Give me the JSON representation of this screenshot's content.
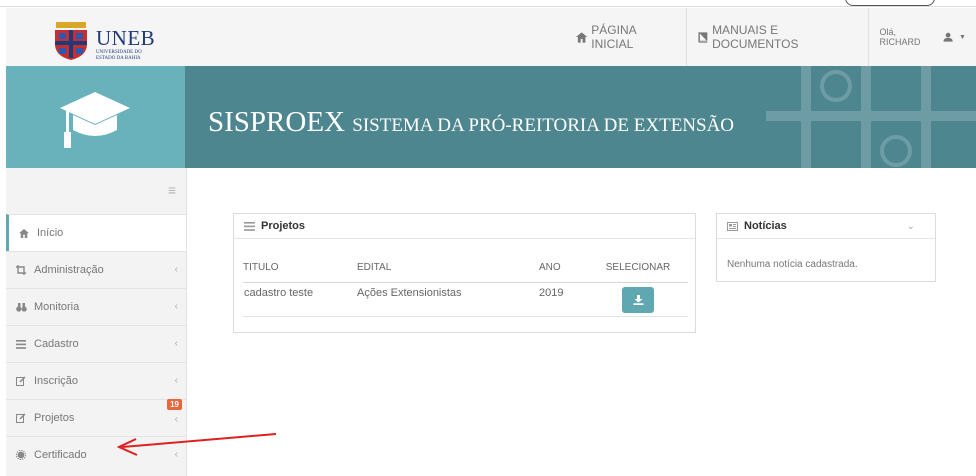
{
  "header": {
    "logo_text": "UNEB",
    "logo_subtitle": "UNIVERSIDADE DO ESTADO DA BAHIA",
    "nav": {
      "home_label": "PÁGINA INICIAL",
      "docs_label": "MANUAIS E DOCUMENTOS",
      "user_label": "Olá, RICHARD"
    }
  },
  "banner": {
    "title_main": "SISPROEX",
    "title_sub": "SISTEMA DA PRÓ-REITORIA DE EXTENSÃO"
  },
  "sidebar": {
    "items": [
      {
        "label": "Início",
        "icon": "home-icon",
        "active": true
      },
      {
        "label": "Administração",
        "icon": "crop-icon"
      },
      {
        "label": "Monitoria",
        "icon": "binoculars-icon"
      },
      {
        "label": "Cadastro",
        "icon": "list-icon"
      },
      {
        "label": "Inscrição",
        "icon": "edit-icon"
      },
      {
        "label": "Projetos",
        "icon": "edit-icon",
        "badge": "19"
      },
      {
        "label": "Certificado",
        "icon": "certificate-icon"
      }
    ]
  },
  "projects_panel": {
    "title": "Projetos",
    "columns": [
      "TITULO",
      "EDITAL",
      "ANO",
      "SELECIONAR"
    ],
    "rows": [
      {
        "titulo": "cadastro teste",
        "edital": "Ações Extensionistas",
        "ano": "2019"
      }
    ]
  },
  "news_panel": {
    "title": "Notícias",
    "empty_text": "Nenhuma notícia cadastrada."
  },
  "colors": {
    "teal_dark": "#4e8690",
    "teal_light": "#69b1bb",
    "accent": "#5fa7b1",
    "badge": "#e8663a",
    "annotation_arrow": "#e02020"
  }
}
